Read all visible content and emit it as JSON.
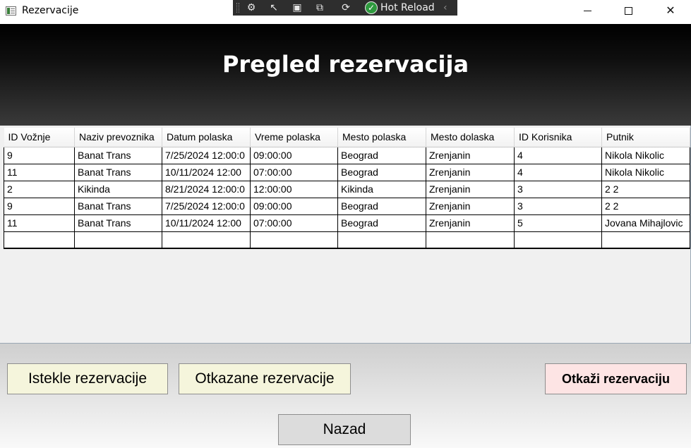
{
  "window": {
    "title": "Rezervacije"
  },
  "devtools": {
    "hot_reload_label": "Hot Reload"
  },
  "header": {
    "title": "Pregled rezervacija"
  },
  "grid": {
    "columns": [
      "ID Vožnje",
      "Naziv prevoznika",
      "Datum polaska",
      "Vreme polaska",
      "Mesto polaska",
      "Mesto dolaska",
      "ID Korisnika",
      "Putnik"
    ],
    "rows": [
      [
        "9",
        "Banat Trans",
        "7/25/2024 12:00:0",
        "09:00:00",
        "Beograd",
        "Zrenjanin",
        "4",
        "Nikola Nikolic"
      ],
      [
        "11",
        "Banat Trans",
        "10/11/2024 12:00",
        "07:00:00",
        "Beograd",
        "Zrenjanin",
        "4",
        "Nikola Nikolic"
      ],
      [
        "2",
        "Kikinda",
        "8/21/2024 12:00:0",
        "12:00:00",
        "Kikinda",
        "Zrenjanin",
        "3",
        "2 2"
      ],
      [
        "9",
        "Banat Trans",
        "7/25/2024 12:00:0",
        "09:00:00",
        "Beograd",
        "Zrenjanin",
        "3",
        "2 2"
      ],
      [
        "11",
        "Banat Trans",
        "10/11/2024 12:00",
        "07:00:00",
        "Beograd",
        "Zrenjanin",
        "5",
        "Jovana Mihajlovic"
      ]
    ]
  },
  "buttons": {
    "istekle": "Istekle rezervacije",
    "otkazane": "Otkazane rezervacije",
    "otkazi": "Otkaži rezervaciju",
    "nazad": "Nazad"
  },
  "colors": {
    "header_top": "#000000",
    "header_bottom": "#3a3a3a",
    "beige_button": "#f5f5dc",
    "pink_button": "#fde4e4",
    "gray_button": "#dcdcdc"
  }
}
